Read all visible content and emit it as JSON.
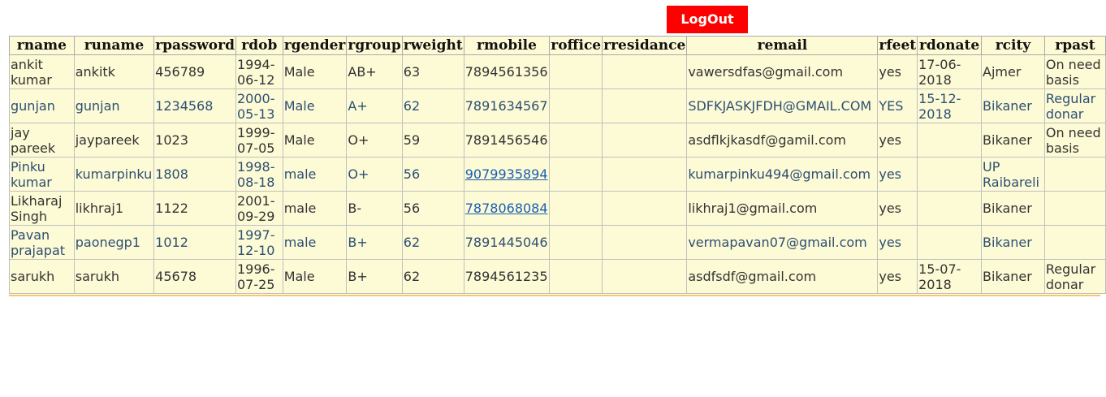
{
  "header": {
    "logout_label": "LogOut"
  },
  "colors": {
    "logout_bg": "#ff0000",
    "table_bg": "#fdfad6",
    "rule": "#f7c56c",
    "link": "#1a5fb4"
  },
  "table": {
    "columns": [
      "rname",
      "runame",
      "rpassword",
      "rdob",
      "rgender",
      "rgroup",
      "rweight",
      "rmobile",
      "roffice",
      "rresidance",
      "remail",
      "rfeet",
      "rdonate",
      "rcity",
      "rpast"
    ],
    "rows": [
      {
        "rname": "ankit kumar",
        "runame": "ankitk",
        "rpassword": "456789",
        "rdob": "1994-06-12",
        "rgender": "Male",
        "rgroup": "AB+",
        "rweight": "63",
        "rmobile": "7894561356",
        "roffice": "",
        "rresidance": "",
        "remail": "vawersdfas@gmail.com",
        "rfeet": "yes",
        "rdonate": "17-06-2018",
        "rcity": "Ajmer",
        "rpast": "On need basis"
      },
      {
        "rname": "gunjan",
        "runame": "gunjan",
        "rpassword": "1234568",
        "rdob": "2000-05-13",
        "rgender": "Male",
        "rgroup": "A+",
        "rweight": "62",
        "rmobile": "7891634567",
        "roffice": "",
        "rresidance": "",
        "remail": "SDFKJASKJFDH@GMAIL.COM",
        "rfeet": "YES",
        "rdonate": "15-12-2018",
        "rcity": "Bikaner",
        "rpast": "Regular donar"
      },
      {
        "rname": "jay pareek",
        "runame": "jaypareek",
        "rpassword": "1023",
        "rdob": "1999-07-05",
        "rgender": "Male",
        "rgroup": "O+",
        "rweight": "59",
        "rmobile": "7891456546",
        "roffice": "",
        "rresidance": "",
        "remail": "asdflkjkasdf@gamil.com",
        "rfeet": "yes",
        "rdonate": "",
        "rcity": "Bikaner",
        "rpast": "On need basis"
      },
      {
        "rname": "Pinku kumar",
        "runame": "kumarpinku",
        "rpassword": "1808",
        "rdob": "1998-08-18",
        "rgender": "male",
        "rgroup": "O+",
        "rweight": "56",
        "rmobile": "9079935894",
        "roffice": "",
        "rresidance": "",
        "remail": "kumarpinku494@gmail.com",
        "rfeet": "yes",
        "rdonate": "",
        "rcity": "UP Raibareli",
        "rpast": ""
      },
      {
        "rname": "Likharaj Singh",
        "runame": "likhraj1",
        "rpassword": "1122",
        "rdob": "2001-09-29",
        "rgender": "male",
        "rgroup": "B-",
        "rweight": "56",
        "rmobile": "7878068084",
        "roffice": "",
        "rresidance": "",
        "remail": "likhraj1@gmail.com",
        "rfeet": "yes",
        "rdonate": "",
        "rcity": "Bikaner",
        "rpast": ""
      },
      {
        "rname": "Pavan prajapat",
        "runame": "paonegp1",
        "rpassword": "1012",
        "rdob": "1997-12-10",
        "rgender": "male",
        "rgroup": "B+",
        "rweight": "62",
        "rmobile": "7891445046",
        "roffice": "",
        "rresidance": "",
        "remail": "vermapavan07@gmail.com",
        "rfeet": "yes",
        "rdonate": "",
        "rcity": "Bikaner",
        "rpast": ""
      },
      {
        "rname": "sarukh",
        "runame": "sarukh",
        "rpassword": "45678",
        "rdob": "1996-07-25",
        "rgender": "Male",
        "rgroup": "B+",
        "rweight": "62",
        "rmobile": "7894561235",
        "roffice": "",
        "rresidance": "",
        "remail": "asdfsdf@gmail.com",
        "rfeet": "yes",
        "rdonate": "15-07-2018",
        "rcity": "Bikaner",
        "rpast": "Regular donar"
      }
    ],
    "link_mobiles": [
      "9079935894",
      "7878068084"
    ]
  }
}
